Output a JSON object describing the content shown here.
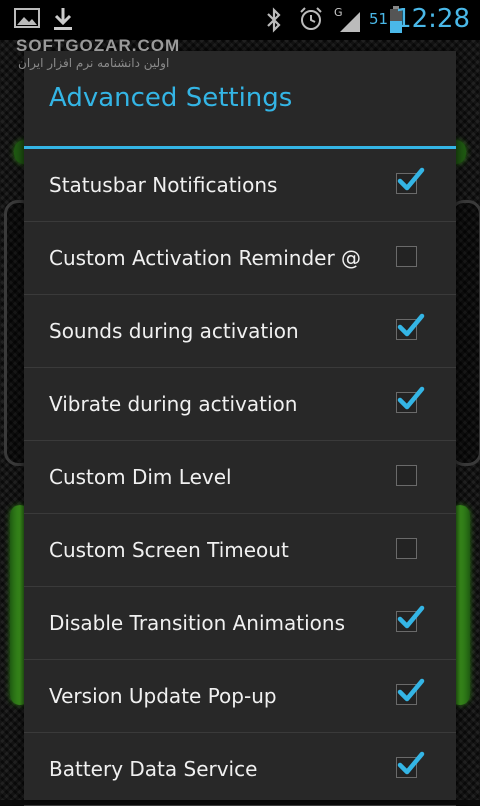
{
  "status_bar": {
    "time": "12:28",
    "battery_level": "51",
    "network_type": "G",
    "icons": [
      "gallery-icon",
      "download-icon",
      "bluetooth-icon",
      "alarm-icon",
      "signal-icon",
      "battery-icon"
    ]
  },
  "watermark": {
    "brand": "SOFTGOZAR.COM",
    "tagline": "اولین دانشنامه نرم افزار ایران"
  },
  "dialog": {
    "title": "Advanced Settings",
    "accent_color": "#34b5e5",
    "items": [
      {
        "label": "Statusbar Notifications",
        "checked": true
      },
      {
        "label": "Custom Activation Reminder @",
        "checked": false
      },
      {
        "label": "Sounds during activation",
        "checked": true
      },
      {
        "label": "Vibrate during activation",
        "checked": true
      },
      {
        "label": "Custom Dim Level",
        "checked": false
      },
      {
        "label": "Custom Screen Timeout",
        "checked": false
      },
      {
        "label": "Disable Transition Animations",
        "checked": true
      },
      {
        "label": "Version Update Pop-up",
        "checked": true
      },
      {
        "label": "Battery Data Service",
        "checked": true
      }
    ]
  }
}
